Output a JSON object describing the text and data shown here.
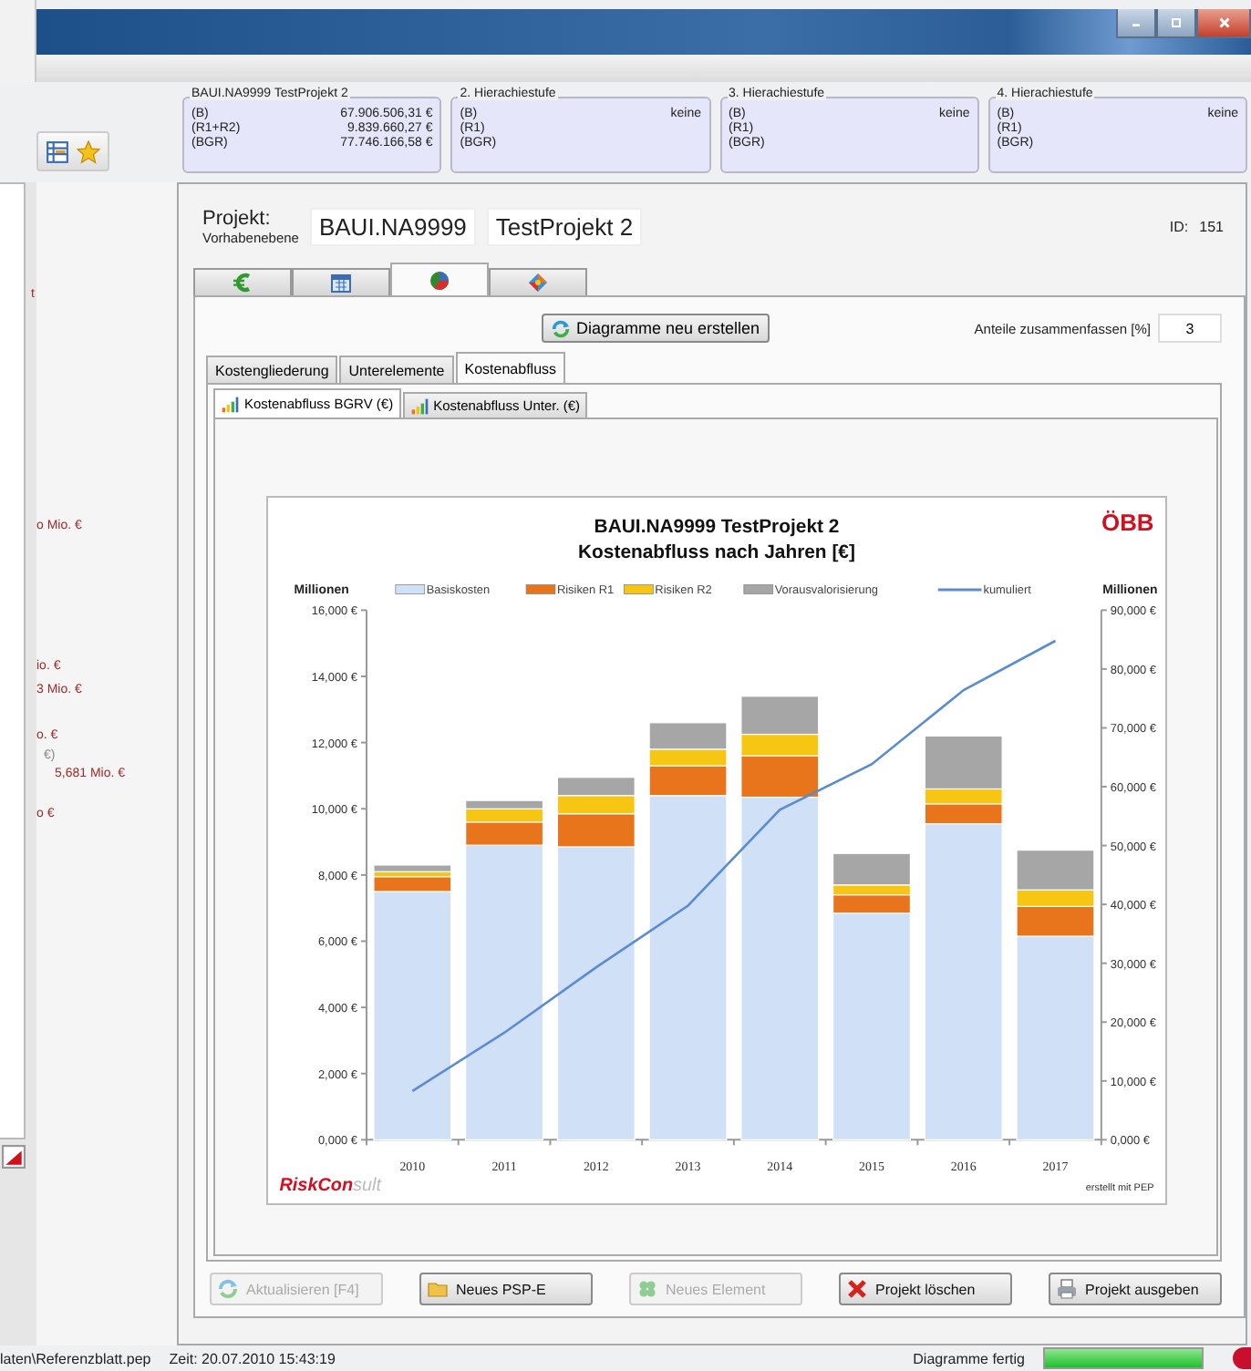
{
  "window": {
    "controls": [
      {
        "kind": "minimize"
      },
      {
        "kind": "maximize"
      },
      {
        "kind": "close"
      }
    ]
  },
  "left_panel": {
    "tools": [
      {
        "kind": "table"
      },
      {
        "kind": "star"
      }
    ],
    "fragments": [
      {
        "text": "t",
        "color": "#9b2a2a"
      },
      {
        "text": "o Mio. €",
        "color": "#9b2a2a"
      },
      {
        "text": "io. €",
        "color": "#9b2a2a"
      },
      {
        "text": "3 Mio. €",
        "color": "#9b2a2a"
      },
      {
        "text": "o. €",
        "color": "#9b2a2a"
      },
      {
        "text": "€)",
        "color": "#888888"
      },
      {
        "text": "5,681 Mio. €",
        "color": "#9b2a2a"
      },
      {
        "text": "o €",
        "color": "#9b2a2a"
      }
    ]
  },
  "summary_boxes": [
    {
      "title": "BAUI.NA9999 TestProjekt 2",
      "rows": [
        {
          "label": "(B)",
          "value": "67.906.506,31 €"
        },
        {
          "label": "(R1+R2)",
          "value": "9.839.660,27 €"
        },
        {
          "label": "(BGR)",
          "value": "77.746.166,58 €"
        }
      ]
    },
    {
      "title": "2. Hierachiestufe",
      "rows": [
        {
          "label": "(B)",
          "value": "keine"
        },
        {
          "label": "(R1)"
        },
        {
          "label": "(BGR)"
        }
      ]
    },
    {
      "title": "3. Hierachiestufe",
      "rows": [
        {
          "label": "(B)",
          "value": "keine"
        },
        {
          "label": "(R1)"
        },
        {
          "label": "(BGR)"
        }
      ]
    },
    {
      "title": "4. Hierachiestufe",
      "rows": [
        {
          "label": "(B)",
          "value": "keine"
        },
        {
          "label": "(R1)"
        },
        {
          "label": "(BGR)"
        }
      ]
    }
  ],
  "project": {
    "label": "Projekt:",
    "sublabel": "Vorhabenebene",
    "code": "BAUI.NA9999",
    "name": "TestProjekt 2",
    "id_label": "ID:",
    "id": "151"
  },
  "icon_tabs": [
    {
      "kind": "euro",
      "selected": false
    },
    {
      "kind": "calendar",
      "selected": false
    },
    {
      "kind": "pie",
      "selected": true
    },
    {
      "kind": "network",
      "selected": false
    }
  ],
  "toolbar": {
    "rebuild_button": "Diagramme neu erstellen",
    "merge_label": "Anteile zusammenfassen [%]",
    "merge_value": "3"
  },
  "tabs": [
    {
      "label": "Kostengliederung",
      "selected": false
    },
    {
      "label": "Unterelemente",
      "selected": false
    },
    {
      "label": "Kostenabfluss",
      "selected": true
    }
  ],
  "chart_tabs": [
    {
      "label": "Kostenabfluss BGRV (€)",
      "selected": true
    },
    {
      "label": "Kostenabfluss Unter. (€)",
      "selected": false
    }
  ],
  "chart": {
    "logo": "ÖBB",
    "brand": "RiskCon",
    "brand_rest": "sult",
    "credit": "erstellt mit PEP",
    "chart_data": {
      "type": "bar",
      "title": "BAUI.NA9999 TestProjekt 2\nKostenabfluss nach Jahren [€]",
      "ylabel": "Millionen",
      "y2label": "Millionen",
      "stacked": true,
      "legend": "top",
      "categories": [
        "2010",
        "2011",
        "2012",
        "2013",
        "2014",
        "2015",
        "2016",
        "2017"
      ],
      "series": [
        {
          "name": "Basiskosten",
          "color": "#cfe0f7",
          "values": [
            7.5,
            8.9,
            8.85,
            10.4,
            10.35,
            6.85,
            9.55,
            6.15
          ]
        },
        {
          "name": "Risiken R1",
          "color": "#e8741c",
          "values": [
            0.45,
            0.7,
            1.0,
            0.9,
            1.25,
            0.55,
            0.6,
            0.9
          ]
        },
        {
          "name": "Risiken R2",
          "color": "#f7c613",
          "values": [
            0.15,
            0.4,
            0.55,
            0.5,
            0.65,
            0.3,
            0.45,
            0.5
          ]
        },
        {
          "name": "Vorausvalorisierung",
          "color": "#a6a6a6",
          "values": [
            0.2,
            0.25,
            0.55,
            0.8,
            1.15,
            0.95,
            1.6,
            1.2
          ]
        },
        {
          "name": "kumuliert",
          "color": "#5b8bd0",
          "type": "line",
          "axis": "y2",
          "values": [
            8.3,
            18.2,
            29.3,
            39.8,
            56.1,
            63.8,
            76.4,
            84.8
          ]
        }
      ],
      "ylim": [
        0,
        16
      ],
      "yticks": [
        {
          "value": 0,
          "label": "0,000 €"
        },
        {
          "value": 2,
          "label": "2,000 €"
        },
        {
          "value": 4,
          "label": "4,000 €"
        },
        {
          "value": 6,
          "label": "6,000 €"
        },
        {
          "value": 8,
          "label": "8,000 €"
        },
        {
          "value": 10,
          "label": "10,000 €"
        },
        {
          "value": 12,
          "label": "12,000 €"
        },
        {
          "value": 14,
          "label": "14,000 €"
        },
        {
          "value": 16,
          "label": "16,000 €"
        }
      ],
      "y2lim": [
        0,
        90
      ],
      "y2ticks": [
        {
          "value": 0,
          "label": "0,000 €"
        },
        {
          "value": 10,
          "label": "10,000 €"
        },
        {
          "value": 20,
          "label": "20,000 €"
        },
        {
          "value": 30,
          "label": "30,000 €"
        },
        {
          "value": 40,
          "label": "40,000 €"
        },
        {
          "value": 50,
          "label": "50,000 €"
        },
        {
          "value": 60,
          "label": "60,000 €"
        },
        {
          "value": 70,
          "label": "70,000 €"
        },
        {
          "value": 80,
          "label": "80,000 €"
        },
        {
          "value": 90,
          "label": "90,000 €"
        }
      ]
    }
  },
  "buttons": [
    {
      "label": "Aktualisieren [F4]",
      "kind": "refresh",
      "disabled": true
    },
    {
      "label": "Neues PSP-E",
      "kind": "folder",
      "disabled": false
    },
    {
      "label": "Neues Element",
      "kind": "clover",
      "disabled": true
    },
    {
      "label": "Projekt löschen",
      "kind": "delete",
      "disabled": false
    },
    {
      "label": "Projekt ausgeben",
      "kind": "print",
      "disabled": false
    }
  ],
  "status_bar": {
    "path": "laten\\Referenzblatt.pep",
    "time": "Zeit: 20.07.2010 15:43:19",
    "message": "Diagramme fertig",
    "level": 1
  }
}
